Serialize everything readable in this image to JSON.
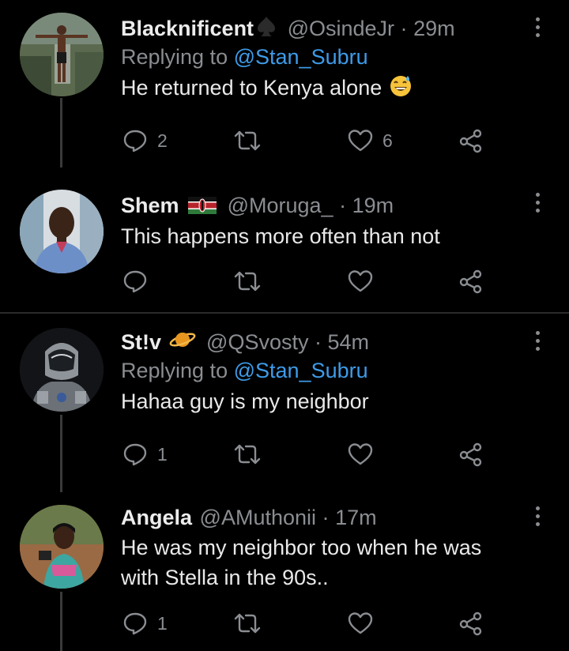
{
  "tweets": [
    {
      "name": "Blacknificent",
      "name_icon": "spade-icon",
      "handle": "@OsindeJr",
      "separator": "·",
      "time": "29m",
      "replying_prefix": "Replying to",
      "replying_to": "@Stan_Subru",
      "text": "He returned to Kenya alone",
      "text_emoji": "grinning-sweat-emoji",
      "reply_count": "2",
      "like_count": "6"
    },
    {
      "name": "Shem",
      "name_icon": "kenya-flag-icon",
      "handle": "@Moruga_",
      "separator": "·",
      "time": "19m",
      "text": "This happens more often than not"
    },
    {
      "name": "St!v",
      "name_icon": "ringed-planet-icon",
      "handle": "@QSvosty",
      "separator": "·",
      "time": "54m",
      "replying_prefix": "Replying to",
      "replying_to": "@Stan_Subru",
      "text": "Hahaa guy is my neighbor",
      "reply_count": "1"
    },
    {
      "name": "Angela",
      "handle": "@AMuthonii",
      "separator": "·",
      "time": "17m",
      "text_line1": "He was my neighbor too when he was",
      "text_line2": "with Stella in the 90s..",
      "reply_count": "1"
    }
  ],
  "colors": {
    "background": "#000000",
    "mention": "#3e9be8",
    "secondary_text": "#8a8d91",
    "primary_text": "#e9e9e9"
  }
}
